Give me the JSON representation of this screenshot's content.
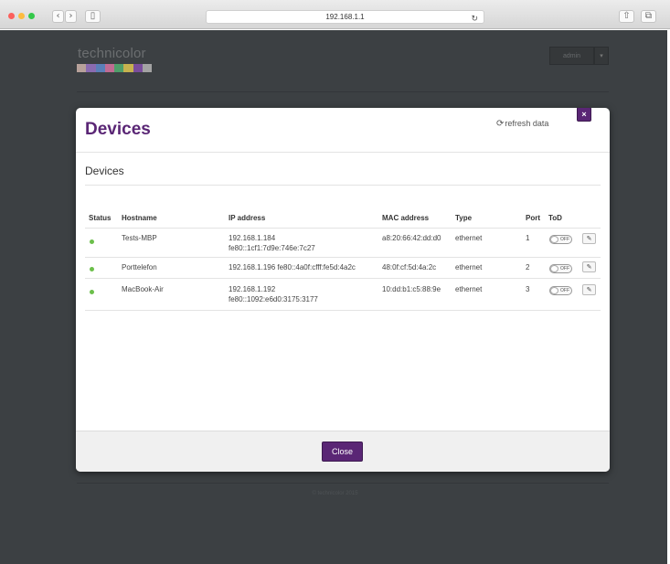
{
  "browser": {
    "address": "192.168.1.1",
    "back_glyph": "‹",
    "forward_glyph": "›",
    "reload_glyph": "↻",
    "sidebar_glyph": "▯",
    "share_glyph": "⇧",
    "tabs_glyph": "⧉"
  },
  "header": {
    "logo_text": "technicolor",
    "user_label": "admin",
    "user_caret": "▾",
    "logo_colors": [
      "#b7a19a",
      "#8a6bb0",
      "#5a7fb8",
      "#c06b93",
      "#4f9e6a",
      "#c7b24e",
      "#7a4d9c",
      "#a3a3a3"
    ]
  },
  "footer": {
    "text": "© technicolor 2015"
  },
  "modal": {
    "title": "Devices",
    "refresh_label": "refresh data",
    "refresh_icon": "⟳",
    "close_x": "×",
    "section_title": "Devices",
    "close_button": "Close",
    "accent_color": "#5a2675",
    "status_online_color": "#6bbf4a",
    "columns": [
      "Status",
      "Hostname",
      "IP address",
      "MAC address",
      "Type",
      "Port",
      "ToD"
    ],
    "rows": [
      {
        "hostname": "Tests-MBP",
        "ip_line1": "192.168.1.184",
        "ip_line2": "fe80::1cf1:7d9e:746e:7c27",
        "mac": "a8:20:66:42:dd:d0",
        "type": "ethernet",
        "port": "1",
        "tod": "OFF"
      },
      {
        "hostname": "Porttelefon",
        "ip_line1": "192.168.1.196 fe80::4a0f:cfff:fe5d:4a2c",
        "ip_line2": "",
        "mac": "48:0f:cf:5d:4a:2c",
        "type": "ethernet",
        "port": "2",
        "tod": "OFF"
      },
      {
        "hostname": "MacBook-Air",
        "ip_line1": "192.168.1.192",
        "ip_line2": "fe80::1092:e6d0:3175:3177",
        "mac": "10:dd:b1:c5:88:9e",
        "type": "ethernet",
        "port": "3",
        "tod": "OFF"
      }
    ]
  }
}
